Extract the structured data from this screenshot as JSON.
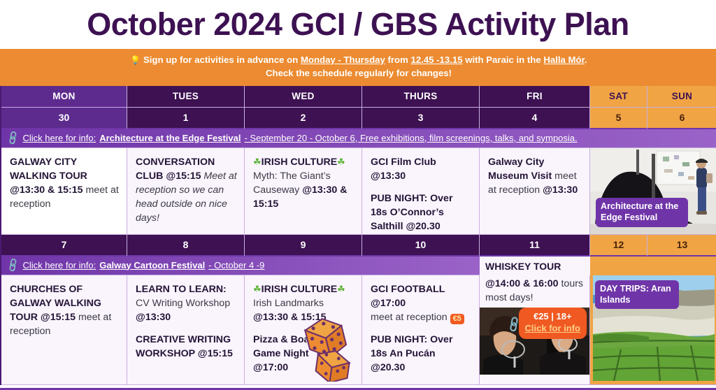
{
  "page": {
    "title": "October 2024 GCI / GBS Activity Plan",
    "accent_purple": "#3d1152",
    "accent_orange": "#ec8b31",
    "ribbon_purple": "#6f35a8"
  },
  "notice": {
    "bulb_icon": "light-bulb-icon",
    "line1_a": "Sign up for activities in advance on ",
    "line1_days": "Monday - Thursday",
    "line1_b": " from ",
    "line1_time": "12.45 -13.15",
    "line1_c": " with Paraic in the ",
    "line1_place": "Halla Mór",
    "line1_d": ".",
    "line2": "Check the schedule regularly for changes!"
  },
  "day_headers": [
    "MON",
    "TUES",
    "WED",
    "THURS",
    "FRI",
    "SAT",
    "SUN"
  ],
  "week1": {
    "dates": [
      "30",
      "1",
      "2",
      "3",
      "4",
      "5",
      "6"
    ],
    "ribbon": {
      "link_icon": "chain-link-icon",
      "click": "Click here for info:",
      "name": "Architecture at the Edge Festival",
      "tail": "- September 20 - October 6, Free exhibitions, film screenings, talks, and symposia."
    },
    "mon": {
      "title": "GALWAY CITY WALKING TOUR",
      "time": "@13:30 & 15:15",
      "note": " meet at reception"
    },
    "tues": {
      "title": "CONVERSATION CLUB",
      "time": "@15:15",
      "note": " Meet at reception so we can head outside on nice days!"
    },
    "wed": {
      "tag": "IRISH CULTURE",
      "body": "Myth: The Giant’s Causeway ",
      "time": "@13:30 & 15:15"
    },
    "thurs": {
      "ev1": "GCI Film Club @13:30",
      "ev2": "PUB NIGHT: Over 18s O’Connor’s Salthill @20.30"
    },
    "fri": {
      "title": "Galway City Museum Visit",
      "note": " meet at reception ",
      "time": "@13:30"
    },
    "weekend_caption": "Architecture at the Edge Festival"
  },
  "week2": {
    "dates": [
      "7",
      "8",
      "9",
      "10",
      "11",
      "12",
      "13"
    ],
    "ribbon": {
      "link_icon": "chain-link-icon",
      "click": "Click here for info:",
      "name": "Galway Cartoon Festival",
      "tail": "- October 4 -9"
    },
    "mon": {
      "title": "CHURCHES OF GALWAY WALKING TOUR @15:15",
      "note": " meet at reception"
    },
    "tues": {
      "t1": "LEARN TO LEARN:",
      "b1": "CV Writing Workshop ",
      "time1": "@13:30",
      "t2": "CREATIVE WRITING WORKSHOP @15:15"
    },
    "wed": {
      "tag": "IRISH CULTURE",
      "body": "Irish Landmarks ",
      "time": "@13:30 & 15:15",
      "ev2": "Pizza & Board Game Night @17:00",
      "decor_icon": "dice-icon"
    },
    "thurs": {
      "ev1": "GCI FOOTBALL @17:00",
      "ev1_note": "meet at reception ",
      "price_badge": "€5",
      "ev2": "PUB NIGHT: Over 18s An Pucán @20.30"
    },
    "fri": {
      "title": "WHISKEY TOUR",
      "time": "@14:00 & 16:00",
      "note": " tours most days!",
      "badge_price": "€25 | 18+",
      "badge_link": "Click for info",
      "badge_icon": "chain-link-icon"
    },
    "weekend_caption": "DAY TRIPS: Aran Islands"
  }
}
